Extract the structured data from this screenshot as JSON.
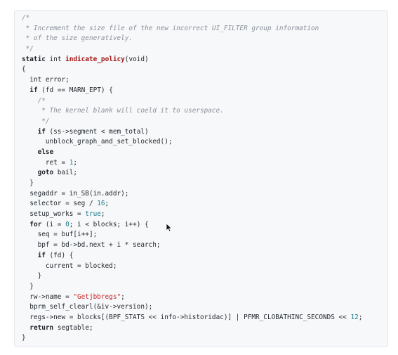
{
  "code": {
    "lines": [
      [
        {
          "t": "comment",
          "v": "/*"
        }
      ],
      [
        {
          "t": "comment",
          "v": " * Increment the size file of the new incorrect UI_FILTER group information"
        }
      ],
      [
        {
          "t": "comment",
          "v": " * of the size generatively."
        }
      ],
      [
        {
          "t": "comment",
          "v": " */"
        }
      ],
      [
        {
          "t": "kw",
          "v": "static"
        },
        {
          "t": "plain",
          "v": " "
        },
        {
          "t": "type",
          "v": "int"
        },
        {
          "t": "plain",
          "v": " "
        },
        {
          "t": "fn",
          "v": "indicate_policy"
        },
        {
          "t": "plain",
          "v": "(void)"
        }
      ],
      [
        {
          "t": "plain",
          "v": "{"
        }
      ],
      [
        {
          "t": "plain",
          "v": "  int error;"
        }
      ],
      [
        {
          "t": "plain",
          "v": "  "
        },
        {
          "t": "kw",
          "v": "if"
        },
        {
          "t": "plain",
          "v": " (fd == MARN_EPT) {"
        }
      ],
      [
        {
          "t": "comment",
          "v": "    /*"
        }
      ],
      [
        {
          "t": "comment",
          "v": "     * The kernel blank will coeld it to userspace."
        }
      ],
      [
        {
          "t": "comment",
          "v": "     */"
        }
      ],
      [
        {
          "t": "plain",
          "v": "    "
        },
        {
          "t": "kw",
          "v": "if"
        },
        {
          "t": "plain",
          "v": " (ss->segment < mem_total)"
        }
      ],
      [
        {
          "t": "plain",
          "v": "      unblock_graph_and_set_blocked();"
        }
      ],
      [
        {
          "t": "plain",
          "v": "    "
        },
        {
          "t": "kw",
          "v": "else"
        }
      ],
      [
        {
          "t": "plain",
          "v": "      ret = "
        },
        {
          "t": "num",
          "v": "1"
        },
        {
          "t": "plain",
          "v": ";"
        }
      ],
      [
        {
          "t": "plain",
          "v": "    "
        },
        {
          "t": "kw",
          "v": "goto"
        },
        {
          "t": "plain",
          "v": " bail;"
        }
      ],
      [
        {
          "t": "plain",
          "v": "  }"
        }
      ],
      [
        {
          "t": "plain",
          "v": "  segaddr = in_SB(in.addr);"
        }
      ],
      [
        {
          "t": "plain",
          "v": "  selector = seg / "
        },
        {
          "t": "num",
          "v": "16"
        },
        {
          "t": "plain",
          "v": ";"
        }
      ],
      [
        {
          "t": "plain",
          "v": "  setup_works = "
        },
        {
          "t": "num",
          "v": "true"
        },
        {
          "t": "plain",
          "v": ";"
        }
      ],
      [
        {
          "t": "plain",
          "v": "  "
        },
        {
          "t": "kw",
          "v": "for"
        },
        {
          "t": "plain",
          "v": " (i = "
        },
        {
          "t": "num",
          "v": "0"
        },
        {
          "t": "plain",
          "v": "; i < blocks; i++) {"
        }
      ],
      [
        {
          "t": "plain",
          "v": "    seq = buf[i++];"
        }
      ],
      [
        {
          "t": "plain",
          "v": "    bpf = bd->bd.next + i * search;"
        }
      ],
      [
        {
          "t": "plain",
          "v": "    "
        },
        {
          "t": "kw",
          "v": "if"
        },
        {
          "t": "plain",
          "v": " (fd) {"
        }
      ],
      [
        {
          "t": "plain",
          "v": "      current = blocked;"
        }
      ],
      [
        {
          "t": "plain",
          "v": "    }"
        }
      ],
      [
        {
          "t": "plain",
          "v": "  }"
        }
      ],
      [
        {
          "t": "plain",
          "v": "  rw->name = "
        },
        {
          "t": "str",
          "v": "\"Getjbbregs\""
        },
        {
          "t": "plain",
          "v": ";"
        }
      ],
      [
        {
          "t": "plain",
          "v": "  bprm_self_clearl(&iv->version);"
        }
      ],
      [
        {
          "t": "plain",
          "v": "  regs->new = blocks[(BPF_STATS << info->historidac)] | PFMR_CLOBATHINC_SECONDS << "
        },
        {
          "t": "num",
          "v": "12"
        },
        {
          "t": "plain",
          "v": ";"
        }
      ],
      [
        {
          "t": "plain",
          "v": "  "
        },
        {
          "t": "kw",
          "v": "return"
        },
        {
          "t": "plain",
          "v": " segtable;"
        }
      ],
      [
        {
          "t": "plain",
          "v": "}"
        }
      ]
    ]
  },
  "icons": {
    "cursor": "mouse-pointer-icon"
  },
  "colors": {
    "panel_bg": "#f6f8fa",
    "comment": "#8a9097",
    "function": "#a31515",
    "number": "#1c7c8c",
    "string": "#c62828"
  }
}
